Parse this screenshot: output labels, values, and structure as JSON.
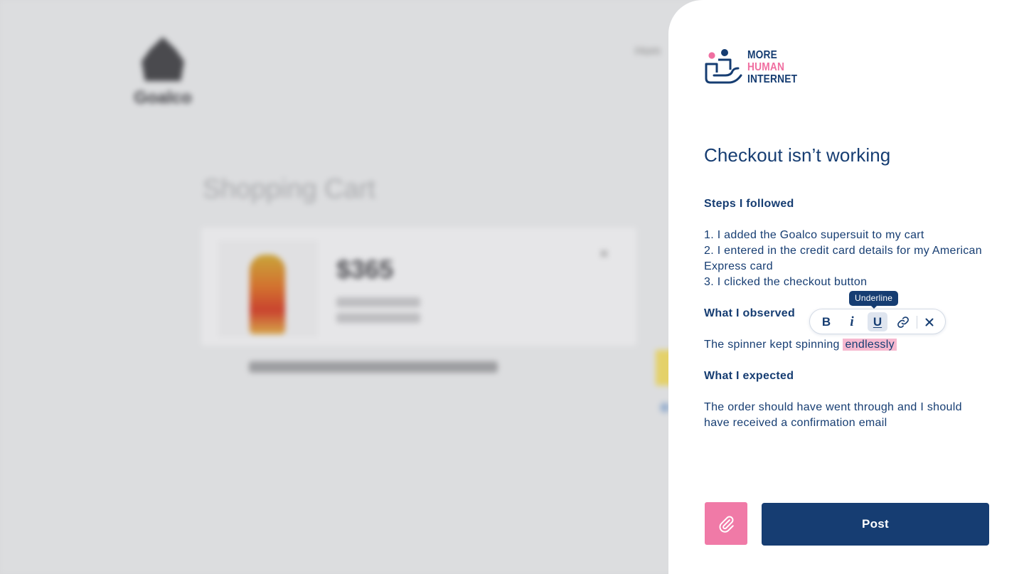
{
  "background": {
    "store_name": "Goalco",
    "page_title": "Shopping Cart",
    "product_name": "$365",
    "remove_glyph": "×"
  },
  "brand": {
    "line1": "MORE",
    "line2": "HUMAN",
    "line3": "INTERNET"
  },
  "issue": {
    "title": "Checkout isn’t working",
    "sections": [
      {
        "heading": "Steps I followed",
        "lines": [
          "1. I added the Goalco supersuit to my cart",
          "2. I entered in the credit card details for my American Express card",
          "3. I clicked the checkout button"
        ]
      },
      {
        "heading": "What I observed",
        "text_before": "The spinner kept spinning ",
        "highlighted": "endlessly"
      },
      {
        "heading": "What I expected",
        "text": "The order should have went through and I should have received a confirmation email"
      }
    ]
  },
  "toolbar": {
    "bold_label": "B",
    "italic_label": "i",
    "underline_label": "U",
    "link_icon": "link-icon",
    "close_icon": "close-icon",
    "tooltip": "Underline"
  },
  "actions": {
    "attach_icon": "paperclip-icon",
    "post_label": "Post"
  },
  "colors": {
    "navy": "#163d72",
    "pink": "#f07aa7",
    "highlight": "#f6b8cf"
  }
}
